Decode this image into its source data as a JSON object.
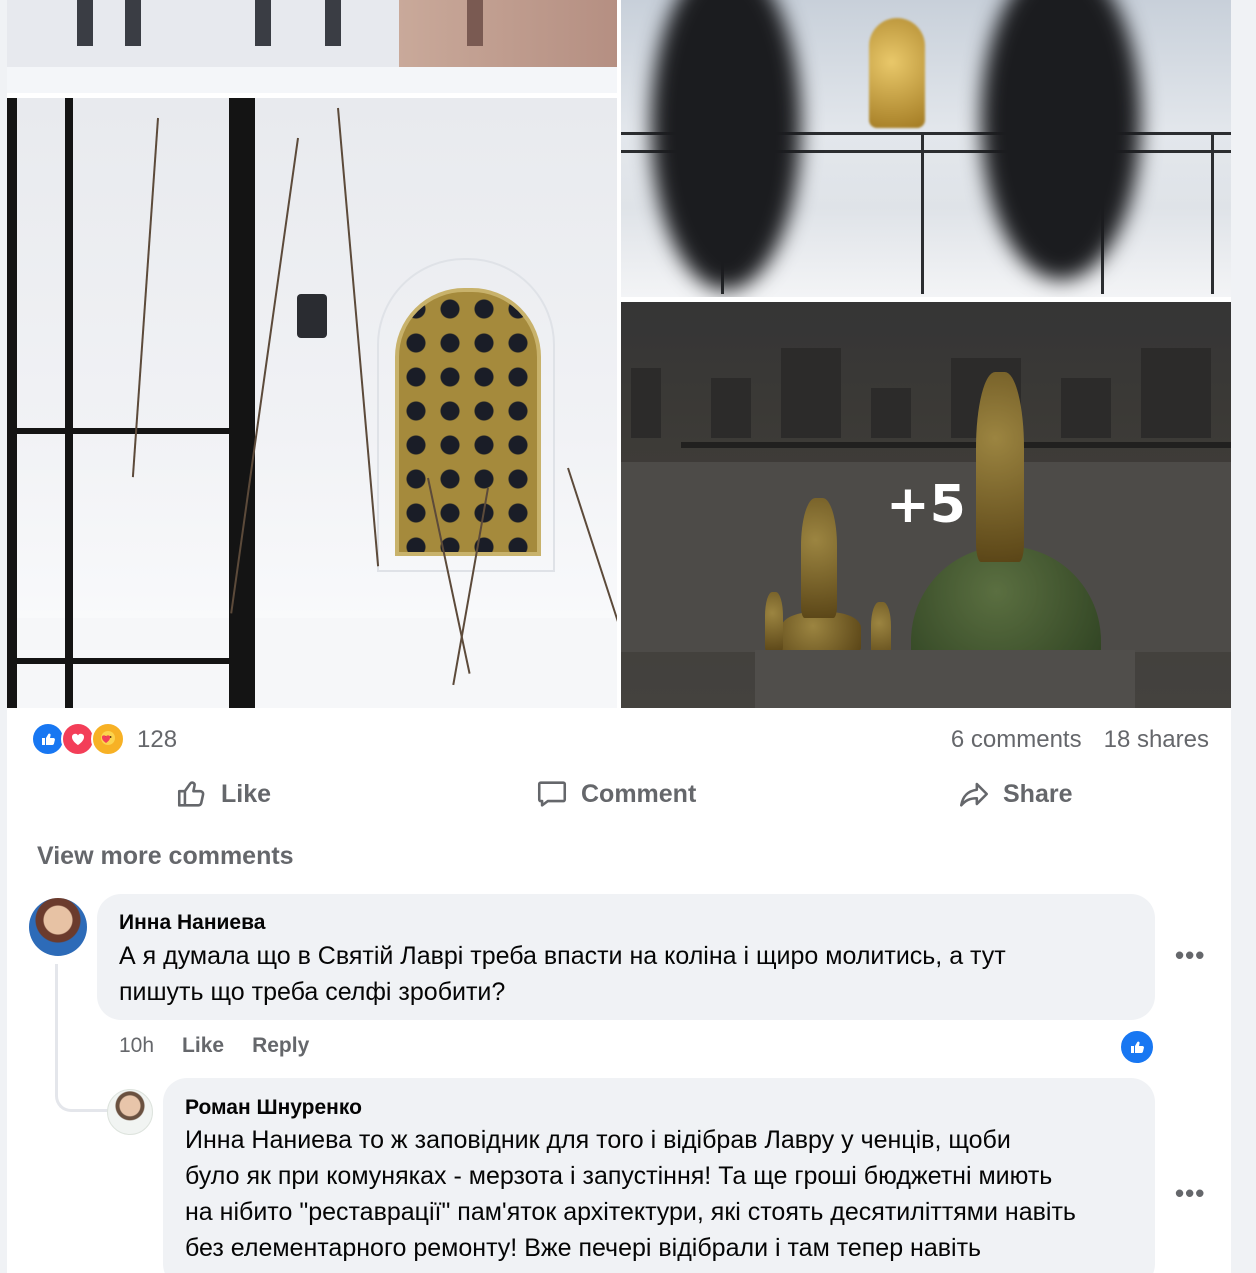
{
  "photos": {
    "more_label": "+5"
  },
  "reactions": {
    "icons": [
      "like-icon",
      "love-icon",
      "care-icon"
    ],
    "count": "128",
    "comments": "6 comments",
    "shares": "18 shares"
  },
  "actions": {
    "like": "Like",
    "comment": "Comment",
    "share": "Share"
  },
  "view_more": "View more comments",
  "comments": [
    {
      "author": "Инна Наниева",
      "text": "А я думала що в Святій Лаврі треба впасти на коліна і щиро молитись, а тут\nпишуть що треба селфі зробити?",
      "time": "10h",
      "like": "Like",
      "reply": "Reply"
    },
    {
      "author": "Роман Шнуренко",
      "text": "Инна Наниева то ж заповідник для того і відібрав Лавру у ченців, щоби\nбуло як при комуняках - мерзота і запустіння! Та ще гроші бюджетні миють\nна нібито \"реставрації\" пам'яток архітектури, які стоять десятиліттями навіть\nбез елементарного ремонту! Вже печері відібрали і там тепер навіть"
    }
  ],
  "colors": {
    "accent": "#1877f2",
    "love": "#f33e58",
    "care": "#f7b125",
    "secondary_text": "#65676b",
    "bubble": "#f0f2f5"
  }
}
